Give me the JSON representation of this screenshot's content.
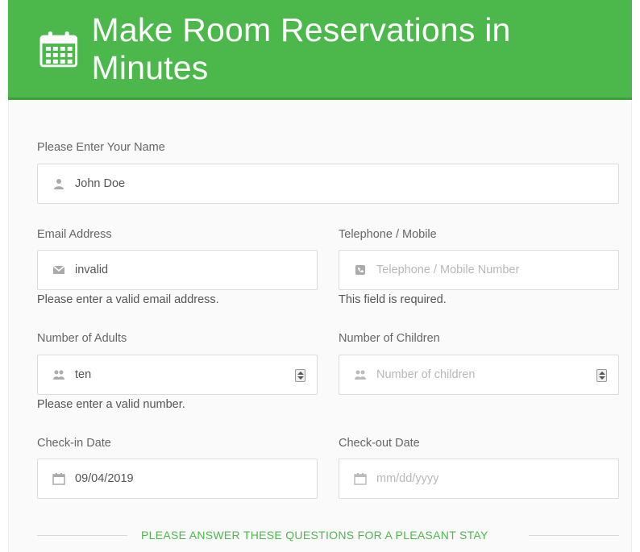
{
  "header": {
    "title": "Make Room Reservations in Minutes",
    "icon": "calendar-icon",
    "background": "#4cb84c"
  },
  "form": {
    "name": {
      "label": "Please Enter Your Name",
      "value": "John Doe",
      "icon": "user-icon"
    },
    "email": {
      "label": "Email Address",
      "value": "invalid",
      "icon": "envelope-icon",
      "error": "Please enter a valid email address."
    },
    "phone": {
      "label": "Telephone / Mobile",
      "placeholder": "Telephone / Mobile Number",
      "icon": "phone-icon",
      "error": "This field is required."
    },
    "adults": {
      "label": "Number of Adults",
      "value": "ten",
      "icon": "people-icon",
      "error": "Please enter a valid number."
    },
    "children": {
      "label": "Number of Children",
      "placeholder": "Number of children",
      "icon": "people-icon"
    },
    "checkin": {
      "label": "Check-in Date",
      "value": "09/04/2019",
      "icon": "calendar-icon"
    },
    "checkout": {
      "label": "Check-out Date",
      "placeholder": "mm/dd/yyyy",
      "icon": "calendar-icon"
    }
  },
  "section": {
    "title": "PLEASE ANSWER THESE QUESTIONS FOR A PLEASANT STAY",
    "color": "#4cb84c"
  }
}
